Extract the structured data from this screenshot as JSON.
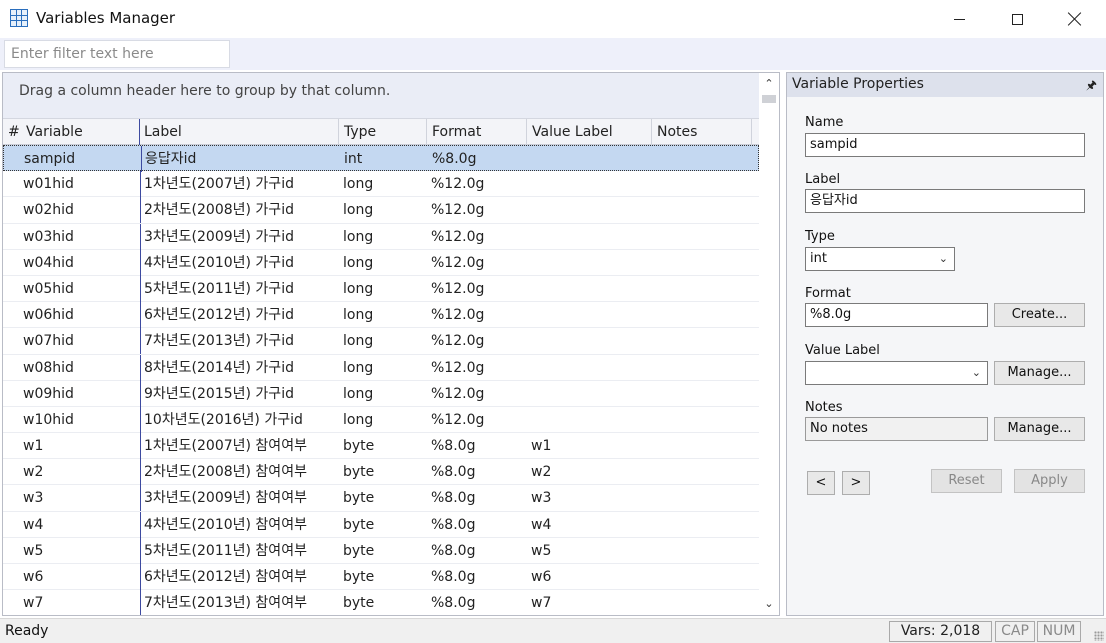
{
  "window": {
    "title": "Variables Manager",
    "icon": "spreadsheet-icon"
  },
  "filter": {
    "placeholder": "Enter filter text here",
    "value": ""
  },
  "grid": {
    "group_hint": "Drag a column header here to group by that column.",
    "columns": {
      "num": "#",
      "variable": "Variable",
      "label": "Label",
      "type": "Type",
      "format": "Format",
      "value_label": "Value Label",
      "notes": "Notes"
    },
    "rows": [
      {
        "variable": "sampid",
        "label": "응답자id",
        "type": "int",
        "format": "%8.0g",
        "value_label": "",
        "notes": "",
        "selected": true
      },
      {
        "variable": "w01hid",
        "label": "1차년도(2007년) 가구id",
        "type": "long",
        "format": "%12.0g",
        "value_label": "",
        "notes": ""
      },
      {
        "variable": "w02hid",
        "label": "2차년도(2008년) 가구id",
        "type": "long",
        "format": "%12.0g",
        "value_label": "",
        "notes": ""
      },
      {
        "variable": "w03hid",
        "label": "3차년도(2009년) 가구id",
        "type": "long",
        "format": "%12.0g",
        "value_label": "",
        "notes": ""
      },
      {
        "variable": "w04hid",
        "label": "4차년도(2010년) 가구id",
        "type": "long",
        "format": "%12.0g",
        "value_label": "",
        "notes": ""
      },
      {
        "variable": "w05hid",
        "label": "5차년도(2011년) 가구id",
        "type": "long",
        "format": "%12.0g",
        "value_label": "",
        "notes": ""
      },
      {
        "variable": "w06hid",
        "label": "6차년도(2012년) 가구id",
        "type": "long",
        "format": "%12.0g",
        "value_label": "",
        "notes": ""
      },
      {
        "variable": "w07hid",
        "label": "7차년도(2013년) 가구id",
        "type": "long",
        "format": "%12.0g",
        "value_label": "",
        "notes": ""
      },
      {
        "variable": "w08hid",
        "label": "8차년도(2014년) 가구id",
        "type": "long",
        "format": "%12.0g",
        "value_label": "",
        "notes": ""
      },
      {
        "variable": "w09hid",
        "label": "9차년도(2015년) 가구id",
        "type": "long",
        "format": "%12.0g",
        "value_label": "",
        "notes": ""
      },
      {
        "variable": "w10hid",
        "label": "10차년도(2016년) 가구id",
        "type": "long",
        "format": "%12.0g",
        "value_label": "",
        "notes": ""
      },
      {
        "variable": "w1",
        "label": "1차년도(2007년) 참여여부",
        "type": "byte",
        "format": "%8.0g",
        "value_label": "w1",
        "notes": ""
      },
      {
        "variable": "w2",
        "label": "2차년도(2008년) 참여여부",
        "type": "byte",
        "format": "%8.0g",
        "value_label": "w2",
        "notes": ""
      },
      {
        "variable": "w3",
        "label": "3차년도(2009년) 참여여부",
        "type": "byte",
        "format": "%8.0g",
        "value_label": "w3",
        "notes": ""
      },
      {
        "variable": "w4",
        "label": "4차년도(2010년) 참여여부",
        "type": "byte",
        "format": "%8.0g",
        "value_label": "w4",
        "notes": ""
      },
      {
        "variable": "w5",
        "label": "5차년도(2011년) 참여여부",
        "type": "byte",
        "format": "%8.0g",
        "value_label": "w5",
        "notes": ""
      },
      {
        "variable": "w6",
        "label": "6차년도(2012년) 참여여부",
        "type": "byte",
        "format": "%8.0g",
        "value_label": "w6",
        "notes": ""
      },
      {
        "variable": "w7",
        "label": "7차년도(2013년) 참여여부",
        "type": "byte",
        "format": "%8.0g",
        "value_label": "w7",
        "notes": ""
      }
    ]
  },
  "properties": {
    "title": "Variable Properties",
    "name_label": "Name",
    "name_value": "sampid",
    "label_label": "Label",
    "label_value": "응답자id",
    "type_label": "Type",
    "type_value": "int",
    "format_label": "Format",
    "format_value": "%8.0g",
    "create_button": "Create...",
    "value_label_label": "Value Label",
    "value_label_value": "",
    "manage_value_label_button": "Manage...",
    "notes_label": "Notes",
    "notes_value": "No notes",
    "manage_notes_button": "Manage...",
    "prev_button": "<",
    "next_button": ">",
    "reset_button": "Reset",
    "apply_button": "Apply"
  },
  "status": {
    "text": "Ready",
    "vars": "Vars: 2,018",
    "cap": "CAP",
    "num": "NUM"
  },
  "colors": {
    "selected_row": "#c4d8f1",
    "group_area": "#eaedf6",
    "column_separator": "#3d4aa0"
  }
}
